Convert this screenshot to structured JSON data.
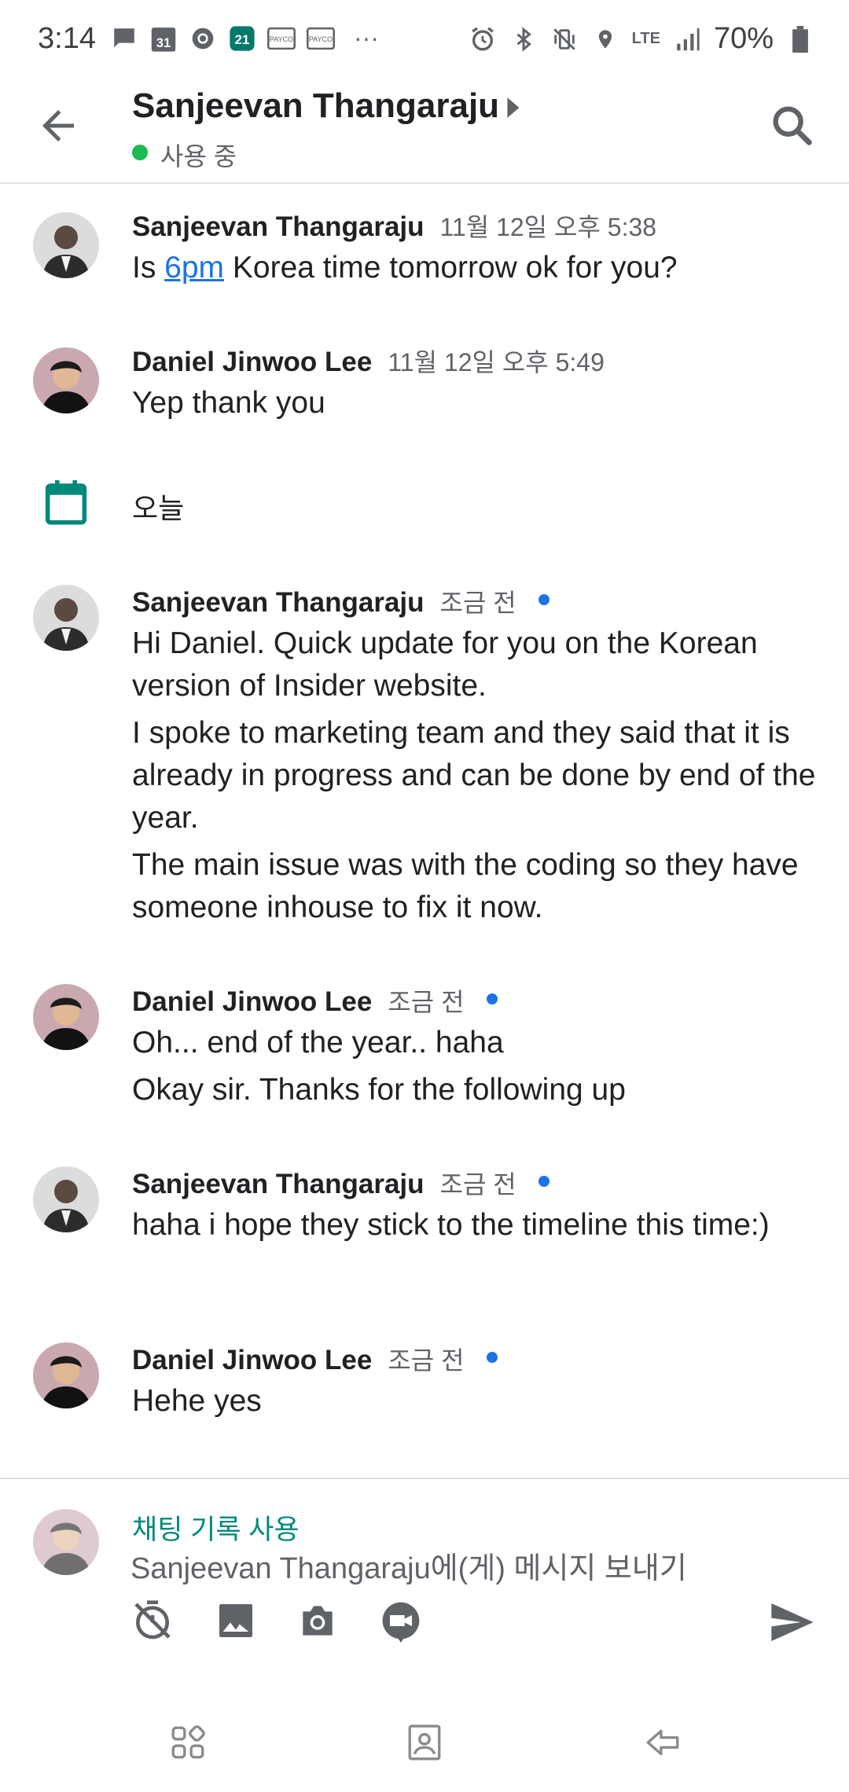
{
  "status_bar": {
    "time": "3:14",
    "calendar_day": "31",
    "app_badge": "21",
    "payco_label": "PAYCO",
    "more": "···",
    "network": "LTE",
    "battery_percent": "70%"
  },
  "header": {
    "title": "Sanjeevan Thangaraju",
    "presence": "사용 중"
  },
  "messages": [
    {
      "sender": "Sanjeevan Thangaraju",
      "time": "11월 12일 오후 5:38",
      "lines": [
        "Is ",
        "6pm",
        " Korea time tomorrow ok for you?"
      ]
    },
    {
      "sender": "Daniel Jinwoo Lee",
      "time": "11월 12일 오후 5:49",
      "lines": [
        "Yep thank you"
      ]
    },
    {
      "sender": "Sanjeevan Thangaraju",
      "time": "조금 전",
      "lines": [
        "Hi Daniel. Quick update for you on the Korean version of Insider website.",
        "I spoke to marketing team and they said that it is already in progress and can be done by end of the year.",
        "The main issue was with the coding so they have someone inhouse to fix it now."
      ]
    },
    {
      "sender": "Daniel Jinwoo Lee",
      "time": "조금 전",
      "lines": [
        "Oh... end of the year.. haha",
        "Okay sir. Thanks for the following up"
      ]
    },
    {
      "sender": "Sanjeevan Thangaraju",
      "time": "조금 전",
      "lines": [
        "haha i hope they stick to the timeline this time:)"
      ]
    },
    {
      "sender": "Daniel Jinwoo Lee",
      "time": "조금 전",
      "lines": [
        "Hehe yes"
      ]
    }
  ],
  "date_separator": "오늘",
  "composer": {
    "history_label": "채팅 기록 사용",
    "placeholder": "Sanjeevan Thangaraju에(게) 메시지 보내기"
  },
  "colors": {
    "accent_teal": "#00897b",
    "link_blue": "#1a73e8",
    "presence_green": "#1db954"
  }
}
